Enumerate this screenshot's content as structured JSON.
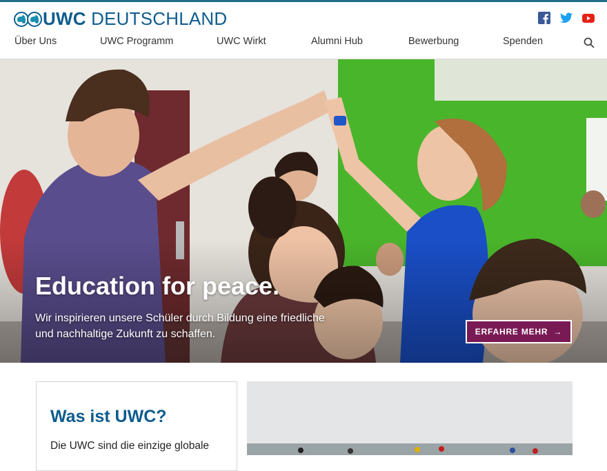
{
  "brand": {
    "logo_text_bold": "UWC",
    "logo_text_rest": " DEUTSCHLAND"
  },
  "social": [
    {
      "icon": "facebook-icon",
      "color": "#3b5998"
    },
    {
      "icon": "twitter-icon",
      "color": "#1da1f2"
    },
    {
      "icon": "youtube-icon",
      "color": "#e62117"
    }
  ],
  "nav": {
    "items": [
      "Über Uns",
      "UWC Programm",
      "UWC Wirkt",
      "Alumni Hub",
      "Bewerbung",
      "Spenden"
    ]
  },
  "hero": {
    "title": "Education for peace.",
    "subtitle": "Wir inspirieren unsere Schüler durch Bildung eine friedliche und nachhaltige Zukunft zu schaffen.",
    "button_label": "ERFAHRE MEHR",
    "button_arrow": "→"
  },
  "intro_card": {
    "title": "Was ist UWC?",
    "text": "Die UWC sind die einzige globale"
  },
  "colors": {
    "brand_blue": "#0e5c8f",
    "button_purple": "#7a1a55",
    "top_line": "#1f6f86"
  }
}
